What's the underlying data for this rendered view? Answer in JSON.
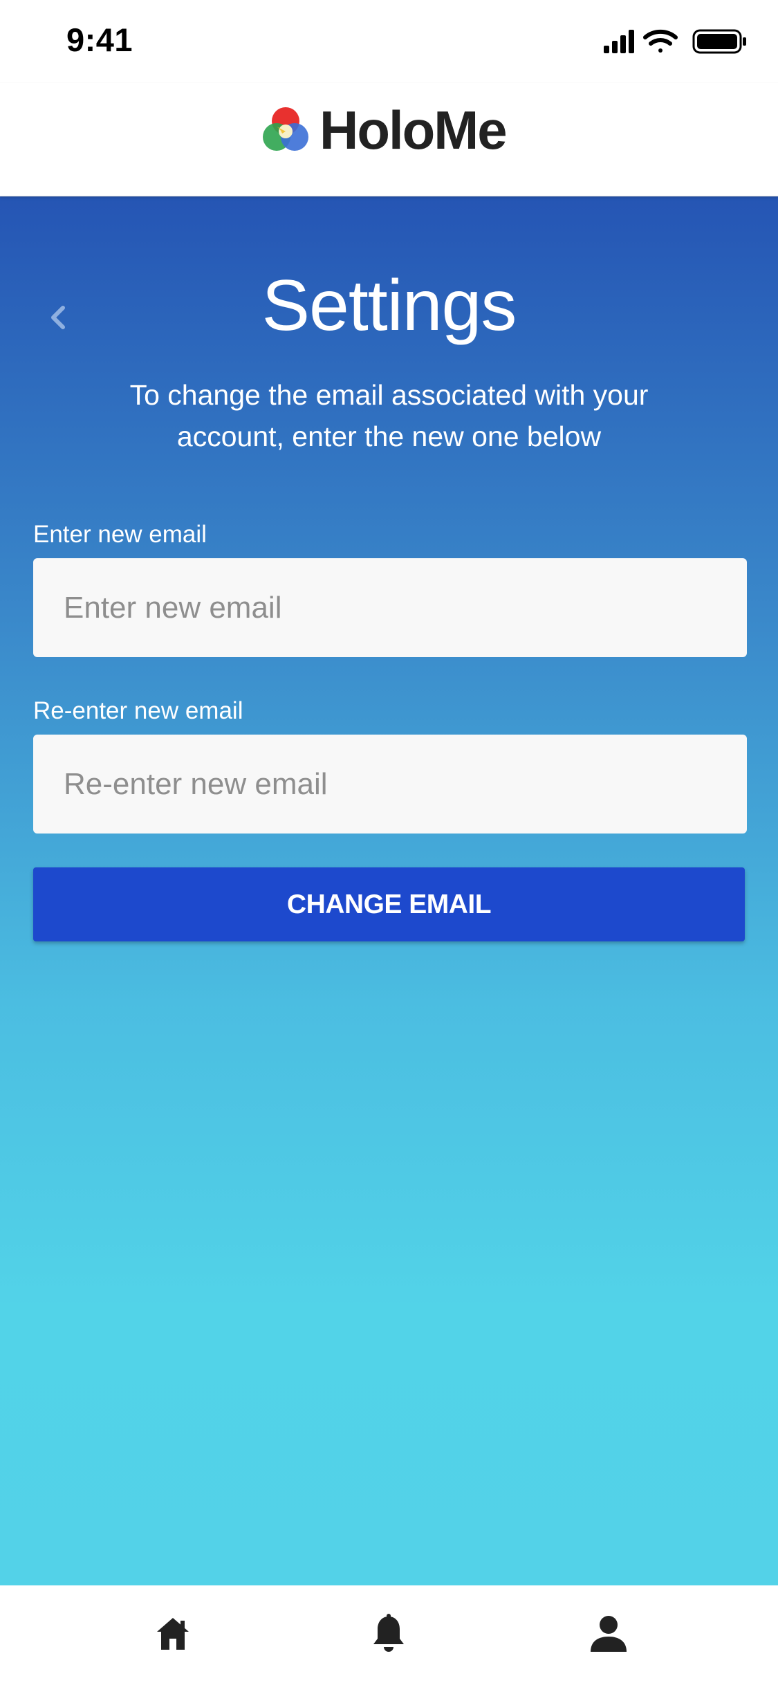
{
  "status_bar": {
    "time": "9:41",
    "icons": [
      "signal-icon",
      "wifi-icon",
      "battery-icon"
    ]
  },
  "header": {
    "app_name": "HoloMe",
    "logo_icon": "holome-logo-icon",
    "logo_colors": [
      "#e8312f",
      "#f2c02c",
      "#2ea44f",
      "#3b6fd6"
    ]
  },
  "settings": {
    "back_icon": "chevron-left-icon",
    "title": "Settings",
    "subtitle": "To change the email associated with your account, enter the new one below",
    "new_email": {
      "label": "Enter new email",
      "value": "",
      "placeholder": "Enter new email"
    },
    "confirm_email": {
      "label": "Re-enter new email",
      "value": "",
      "placeholder": "Re-enter new email"
    },
    "submit_label": "CHANGE EMAIL"
  },
  "tab_bar": {
    "items": [
      {
        "icon": "home-icon"
      },
      {
        "icon": "bell-icon"
      },
      {
        "icon": "profile-icon"
      }
    ]
  },
  "colors": {
    "gradient_top": "#2555b4",
    "gradient_bottom": "#53d2e8",
    "button": "#1d49cd",
    "input_background": "#f8f8f8"
  }
}
